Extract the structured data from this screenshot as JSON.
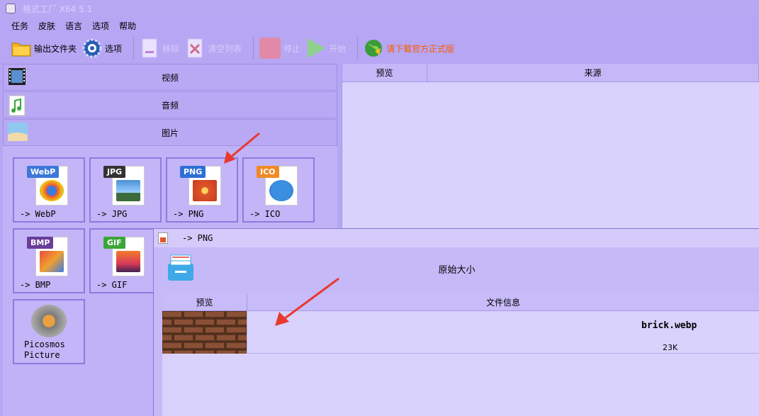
{
  "window": {
    "title": "格式工厂 X64 5.1"
  },
  "menu": [
    "任务",
    "皮肤",
    "语言",
    "选项",
    "帮助"
  ],
  "toolbar": {
    "output_folder": "输出文件夹",
    "options": "选项",
    "remove": "移除",
    "clear_list": "清空列表",
    "stop": "停止",
    "start": "开始",
    "download_official": "请下载官方正式版"
  },
  "categories": [
    {
      "label": "视频",
      "icon": "video-icon"
    },
    {
      "label": "音频",
      "icon": "audio-icon"
    },
    {
      "label": "图片",
      "icon": "image-icon"
    }
  ],
  "formats": [
    {
      "badge": "WebP",
      "label": "-> WebP",
      "color": "#3c78d8",
      "icon": "chrome-icon"
    },
    {
      "badge": "JPG",
      "label": "-> JPG",
      "color": "#333333",
      "icon": "landscape-icon"
    },
    {
      "badge": "PNG",
      "label": "-> PNG",
      "color": "#2e6fd6",
      "icon": "flower-icon"
    },
    {
      "badge": "ICO",
      "label": "-> ICO",
      "color": "#f08a24",
      "icon": "info-icon"
    },
    {
      "badge": "BMP",
      "label": "-> BMP",
      "color": "#6a3d9a",
      "icon": "paint-icon"
    },
    {
      "badge": "GIF",
      "label": "-> GIF",
      "color": "#3aa63a",
      "icon": "sunset-icon"
    },
    {
      "badge": "",
      "label": "Picosmos Picture",
      "color": "#888888",
      "icon": "picosmos-icon"
    }
  ],
  "source_list": {
    "col_preview": "预览",
    "col_source": "来源"
  },
  "dialog": {
    "title": "-> PNG",
    "size_label": "原始大小",
    "table": {
      "col_preview": "预览",
      "col_info": "文件信息",
      "rows": [
        {
          "file_name": "brick.webp",
          "file_size": "23K"
        }
      ]
    }
  },
  "colors": {
    "annotation_arrow": "#e8392f"
  }
}
